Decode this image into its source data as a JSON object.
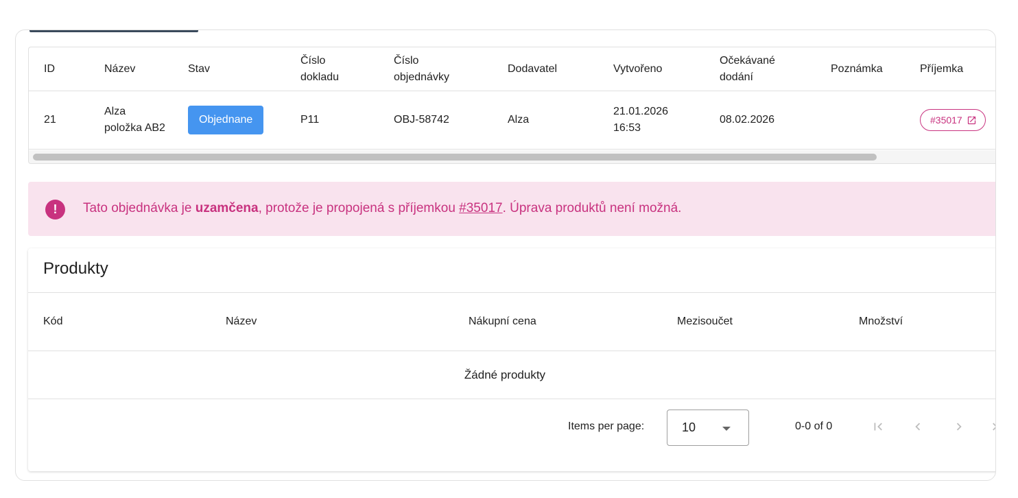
{
  "order_table": {
    "headers": [
      "ID",
      "Název",
      "Stav",
      "Číslo dokladu",
      "Číslo objednávky",
      "Dodavatel",
      "Vytvořeno",
      "Očekávané dodání",
      "Poznámka",
      "Příjemka"
    ],
    "row": {
      "id": "21",
      "name": "Alza položka AB2",
      "status": "Objednane",
      "doc_number": "P11",
      "order_number": "OBJ-58742",
      "supplier": "Alza",
      "created": "21.01.2026 16:53",
      "expected": "08.02.2026",
      "note": "",
      "receipt": "#35017"
    }
  },
  "alert": {
    "text_before": "Tato objednávka je ",
    "bold": "uzamčena",
    "text_middle": ", protože je propojená s příjemkou ",
    "link": "#35017",
    "text_after": ". Úprava produktů není možná."
  },
  "products": {
    "title": "Produkty",
    "headers": [
      "Kód",
      "Název",
      "Nákupní cena",
      "Mezisoučet",
      "Množství"
    ],
    "empty_text": "Žádné produkty"
  },
  "paginator": {
    "items_per_page_label": "Items per page:",
    "page_size": "10",
    "range_label": "0-0 of 0"
  },
  "colors": {
    "accent_pink": "#c8327f",
    "alert_bg": "#f9e3ee",
    "status_blue": "#4595f0"
  }
}
